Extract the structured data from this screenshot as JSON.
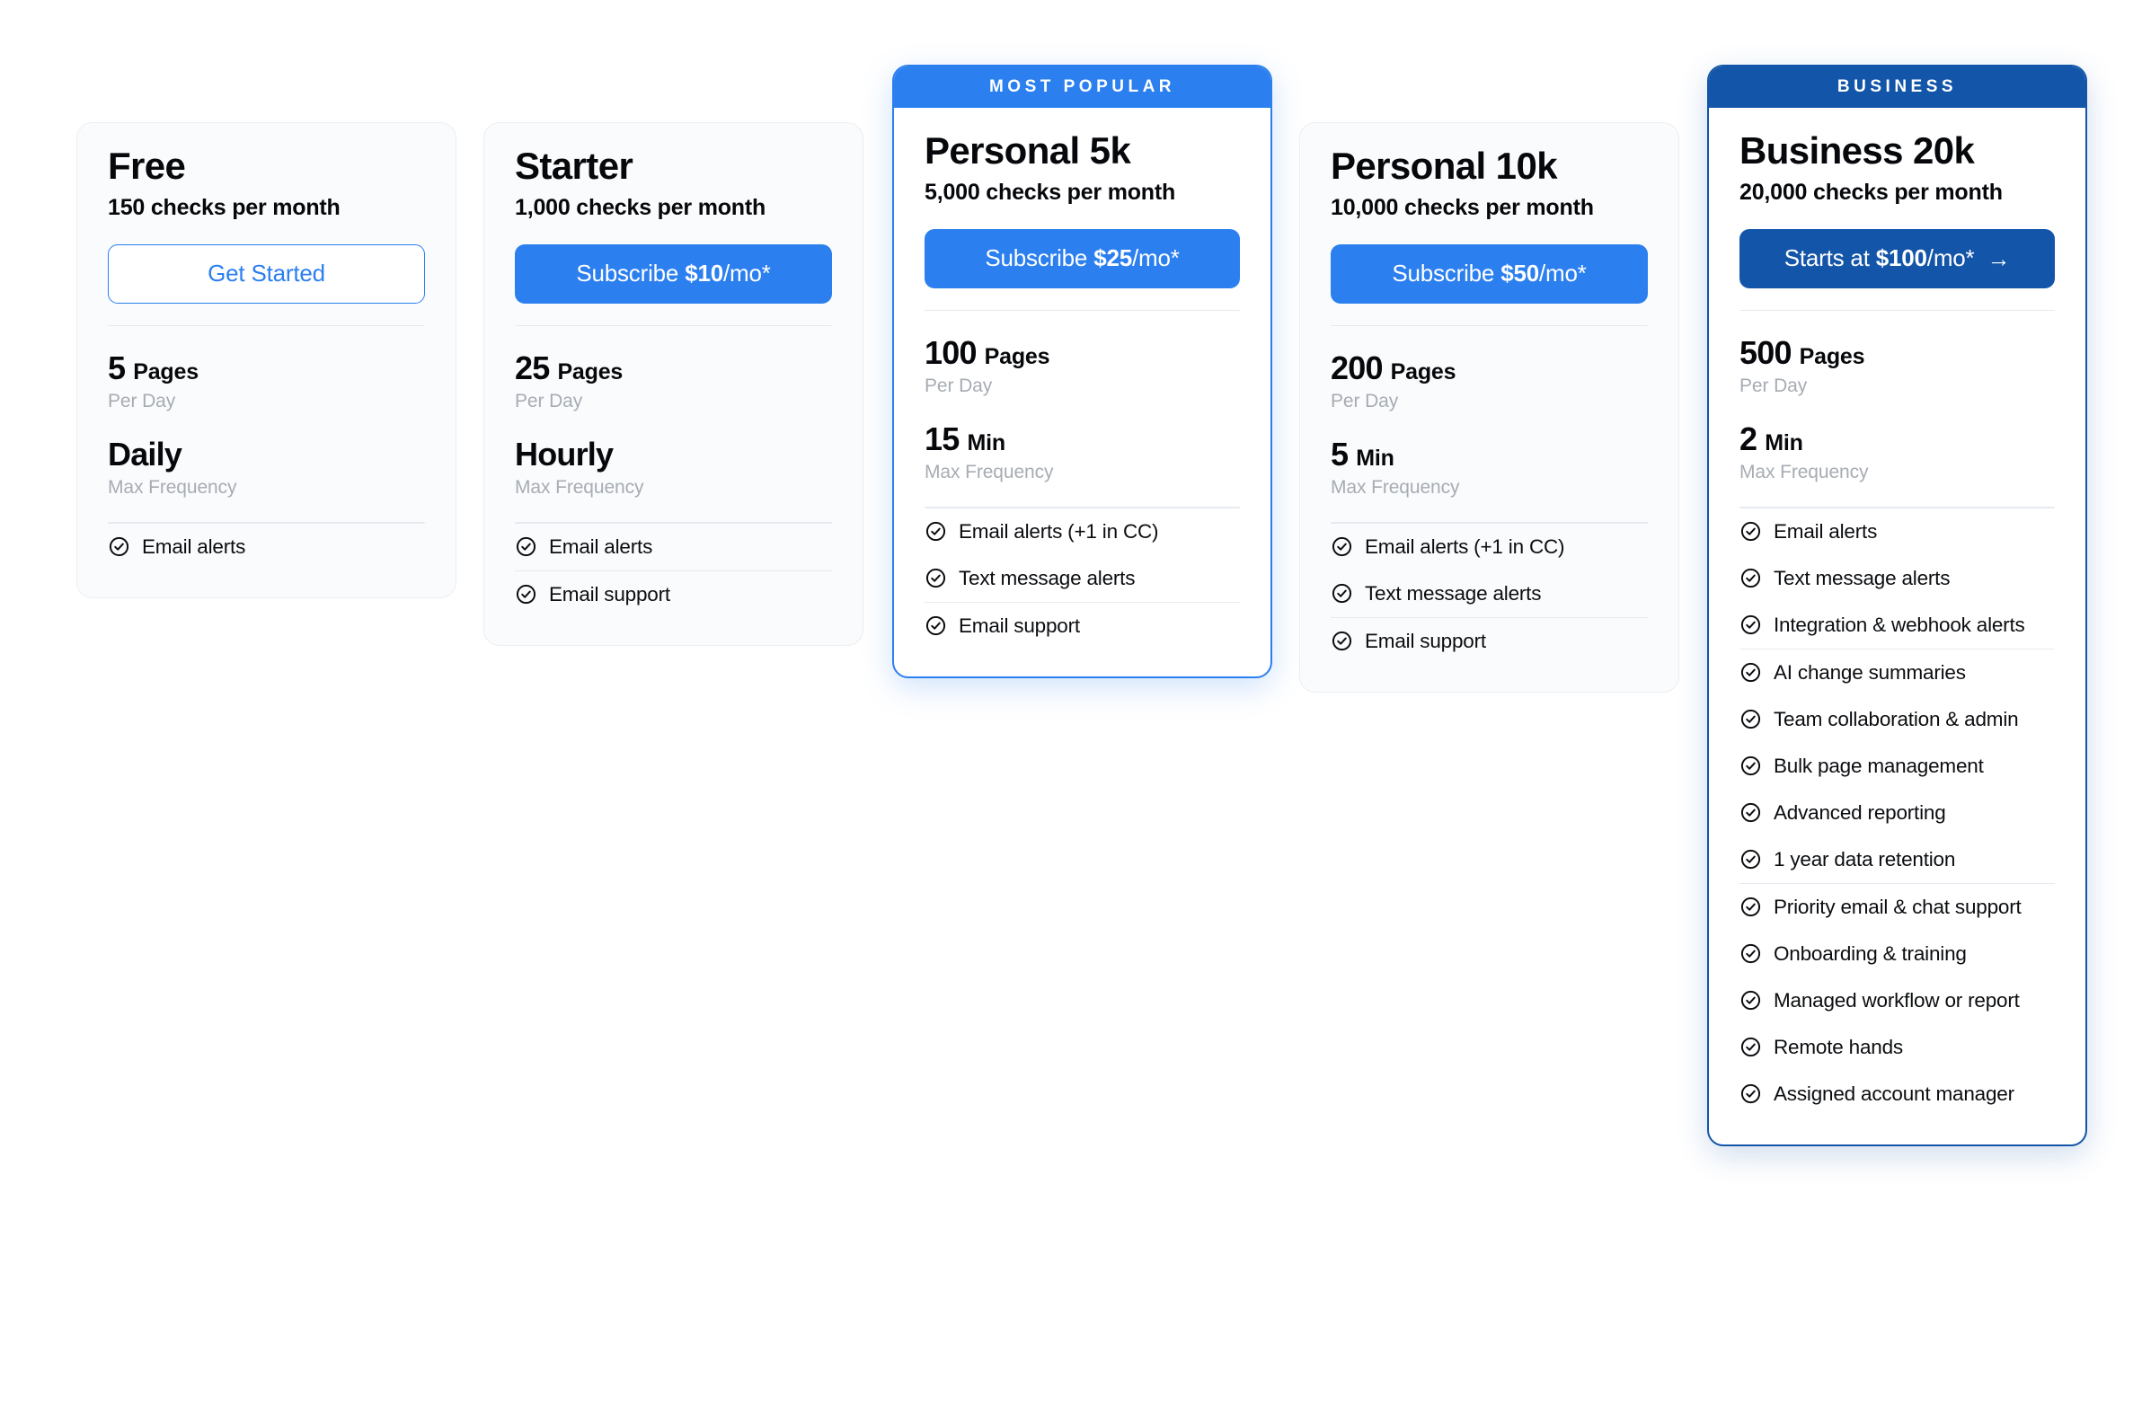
{
  "theme": {
    "accent_blue": "#2b7fef",
    "business_blue": "#1355A8",
    "page_background": "#ffffff",
    "card_background": "#fafbfc",
    "muted_text": "#a7acb3",
    "divider": "#e6eaf0"
  },
  "plans": [
    {
      "id": "free",
      "banner": null,
      "title": "Free",
      "subtitle": "150 checks per month",
      "cta": {
        "style": "outline",
        "lead": "Get Started",
        "price": "",
        "tail": "",
        "star": "",
        "arrow": false
      },
      "stats": [
        {
          "value": "5",
          "unit": "Pages",
          "caption": "Per Day"
        },
        {
          "value": "Daily",
          "unit": "",
          "caption": "Max Frequency"
        }
      ],
      "feature_groups": [
        [
          "Email alerts"
        ]
      ]
    },
    {
      "id": "starter",
      "banner": null,
      "title": "Starter",
      "subtitle": "1,000 checks per month",
      "cta": {
        "style": "solid",
        "lead": "Subscribe ",
        "price": "$10",
        "tail": "/mo",
        "star": "*",
        "arrow": false
      },
      "stats": [
        {
          "value": "25",
          "unit": "Pages",
          "caption": "Per Day"
        },
        {
          "value": "Hourly",
          "unit": "",
          "caption": "Max Frequency"
        }
      ],
      "feature_groups": [
        [
          "Email alerts"
        ],
        [
          "Email support"
        ]
      ]
    },
    {
      "id": "personal-5k",
      "banner": {
        "label": "MOST POPULAR",
        "style": "popular"
      },
      "title": "Personal 5k",
      "subtitle": "5,000 checks per month",
      "cta": {
        "style": "solid",
        "lead": "Subscribe ",
        "price": "$25",
        "tail": "/mo",
        "star": "*",
        "arrow": false
      },
      "stats": [
        {
          "value": "100",
          "unit": "Pages",
          "caption": "Per Day"
        },
        {
          "value": "15",
          "unit": "Min",
          "caption": "Max Frequency"
        }
      ],
      "feature_groups": [
        [
          "Email alerts (+1 in CC)",
          "Text message alerts"
        ],
        [
          "Email support"
        ]
      ]
    },
    {
      "id": "personal-10k",
      "banner": null,
      "title": "Personal 10k",
      "subtitle": "10,000 checks per month",
      "cta": {
        "style": "solid",
        "lead": "Subscribe ",
        "price": "$50",
        "tail": "/mo",
        "star": "*",
        "arrow": false
      },
      "stats": [
        {
          "value": "200",
          "unit": "Pages",
          "caption": "Per Day"
        },
        {
          "value": "5",
          "unit": "Min",
          "caption": "Max Frequency"
        }
      ],
      "feature_groups": [
        [
          "Email alerts (+1 in CC)",
          "Text message alerts"
        ],
        [
          "Email support"
        ]
      ]
    },
    {
      "id": "business-20k",
      "banner": {
        "label": "BUSINESS",
        "style": "biz"
      },
      "title": "Business 20k",
      "subtitle": "20,000 checks per month",
      "cta": {
        "style": "solid-dark",
        "lead": "Starts at ",
        "price": "$100",
        "tail": "/mo",
        "star": "*",
        "arrow": true,
        "arrow_glyph": "→"
      },
      "stats": [
        {
          "value": "500",
          "unit": "Pages",
          "caption": "Per Day"
        },
        {
          "value": "2",
          "unit": "Min",
          "caption": "Max Frequency"
        }
      ],
      "feature_groups": [
        [
          "Email alerts",
          "Text message alerts",
          "Integration & webhook alerts"
        ],
        [
          "AI change summaries",
          "Team collaboration & admin",
          "Bulk page management",
          "Advanced reporting",
          "1 year data retention"
        ],
        [
          "Priority email & chat support",
          "Onboarding & training",
          "Managed workflow or report",
          "Remote hands",
          "Assigned account manager"
        ]
      ]
    }
  ]
}
